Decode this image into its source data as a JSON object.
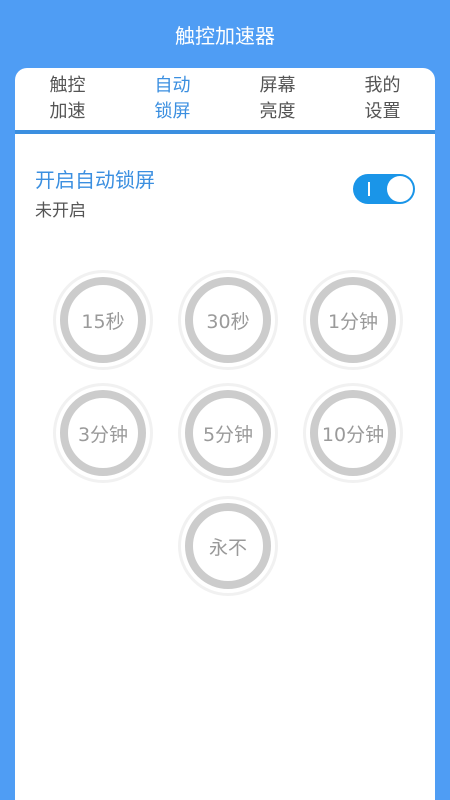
{
  "app": {
    "title": "触控加速器"
  },
  "tabs": [
    {
      "line1": "触控",
      "line2": "加速",
      "active": false
    },
    {
      "line1": "自动",
      "line2": "锁屏",
      "active": true
    },
    {
      "line1": "屏幕",
      "line2": "亮度",
      "active": false
    },
    {
      "line1": "我的",
      "line2": "设置",
      "active": false
    }
  ],
  "auto_lock": {
    "title": "开启自动锁屏",
    "status": "未开启",
    "toggle_on": true
  },
  "timeouts": [
    {
      "label": "15秒"
    },
    {
      "label": "30秒"
    },
    {
      "label": "1分钟"
    },
    {
      "label": "3分钟"
    },
    {
      "label": "5分钟"
    },
    {
      "label": "10分钟"
    },
    {
      "label": "永不"
    }
  ],
  "colors": {
    "background": "#4f9df4",
    "accent": "#3b8fe0",
    "toggle": "#1a95e8",
    "ring": "#cccccc"
  }
}
